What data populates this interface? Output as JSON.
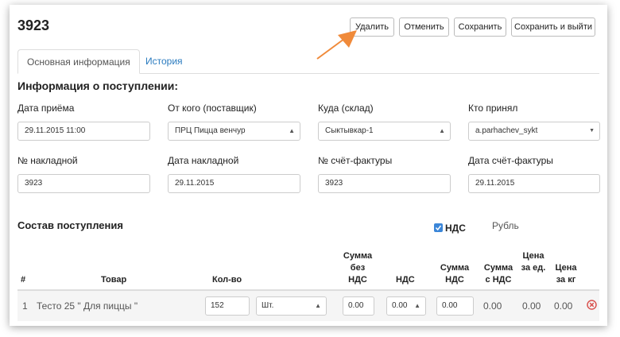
{
  "header": {
    "title": "3923",
    "buttons": {
      "delete": "Удалить",
      "cancel": "Отменить",
      "save": "Сохранить",
      "save_exit": "Сохранить и выйти"
    }
  },
  "tabs": [
    {
      "label": "Основная информация",
      "active": true
    },
    {
      "label": "История",
      "active": false
    }
  ],
  "info": {
    "heading": "Информация о поступлении:",
    "fields": {
      "date_received": {
        "label": "Дата приёма",
        "value": "29.11.2015 11:00"
      },
      "supplier": {
        "label": "От кого (поставщик)",
        "value": "ПРЦ Пицца венчур"
      },
      "warehouse": {
        "label": "Куда (склад)",
        "value": "Сыктывкар-1"
      },
      "received_by": {
        "label": "Кто принял",
        "value": "a.parhachev_sykt"
      },
      "invoice_no": {
        "label": "№ накладной",
        "value": "3923"
      },
      "invoice_date": {
        "label": "Дата накладной",
        "value": "29.11.2015"
      },
      "vat_invoice_no": {
        "label": "№ счёт-фактуры",
        "value": "3923"
      },
      "vat_invoice_date": {
        "label": "Дата счёт-фактуры",
        "value": "29.11.2015"
      }
    }
  },
  "composition": {
    "heading": "Состав поступления",
    "vat_checkbox_label": "НДС",
    "vat_checked": true,
    "currency": "Рубль",
    "columns": {
      "num": "#",
      "product": "Товар",
      "qty": "Кол-во",
      "sum_no_vat": "Сумма без НДС",
      "vat": "НДС",
      "sum_vat": "Сумма НДС",
      "sum_with_vat": "Сумма с НДС",
      "price_unit": "Цена за ед.",
      "price_kg": "Цена за кг"
    },
    "rows": [
      {
        "num": "1",
        "product": "Тесто 25 \" Для пиццы \"",
        "qty": "152",
        "unit": "Шт.",
        "sum_no_vat": "0.00",
        "vat": "0.00",
        "sum_vat": "0.00",
        "sum_with_vat": "0.00",
        "price_unit": "0.00",
        "price_kg": "0.00"
      }
    ]
  },
  "colors": {
    "accent_link": "#2a7bbf",
    "checkbox": "#3b86d8",
    "remove_icon": "#d9534f",
    "annotation_arrow": "#f08a3a"
  },
  "icons": {
    "select": "up-down-caret",
    "dropdown": "chevron-down",
    "remove": "circle-x",
    "pointer": "arrow"
  }
}
